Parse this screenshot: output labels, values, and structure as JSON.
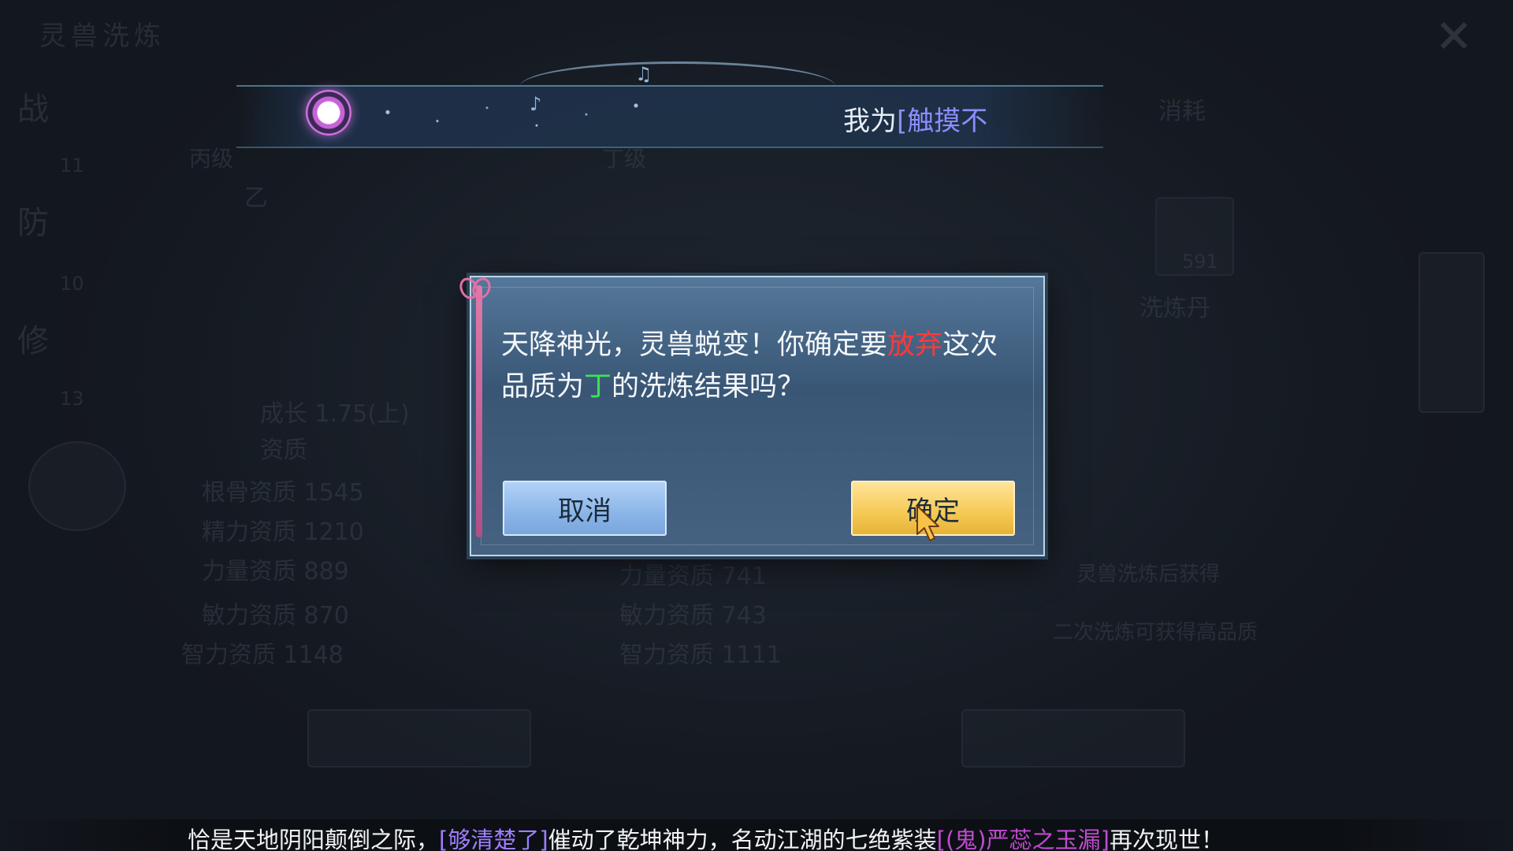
{
  "background": {
    "top_title": "灵兽洗炼",
    "side_tabs": [
      "战",
      "防",
      "修"
    ],
    "side_values": [
      "11",
      "10",
      "13"
    ],
    "right_header": "消耗",
    "center_tabs": [
      "丙级",
      "丁级"
    ],
    "left_grade": "乙",
    "stats_left": [
      "成长  1.75(上)",
      "资质",
      "根骨资质  1545",
      "精力资质  1210",
      "力量资质  889",
      "敏力资质  870",
      "智力资质  1148"
    ],
    "stats_right": [
      "力量资质  741",
      "敏力资质  743",
      "智力资质  1111"
    ],
    "right_count": "591",
    "right_label": "洗炼丹",
    "right_note": "灵兽洗炼后获得",
    "right_note2": "二次洗炼可获得高品质"
  },
  "broadcast": {
    "prefix": "我为",
    "highlight": "[触摸不",
    "accent_color": "#8d8cff"
  },
  "dialog": {
    "message_part1": "天降神光，灵兽蜕变！你确定要",
    "message_red": "放弃",
    "message_part2": "这次品质为",
    "message_green": "丁",
    "message_part3": "的洗炼结果吗？",
    "cancel_label": "取消",
    "confirm_label": "确定",
    "colors": {
      "warning": "#ff3a3a",
      "grade": "#3ee05a",
      "confirm": "#f5c953",
      "cancel": "#8bb5e8"
    }
  },
  "ticker": {
    "part1": "恰是天地阴阳颠倒之际，",
    "player": "[够清楚了]",
    "part2": "催动了乾坤神力，名动江湖的七绝紫装",
    "item": "[(鬼)严蕊之玉漏]",
    "part3": "再次现世！"
  },
  "icons": [
    "music-disc-icon",
    "music-note-icon",
    "close-icon",
    "bow-ribbon-icon",
    "mouse-cursor-icon"
  ]
}
